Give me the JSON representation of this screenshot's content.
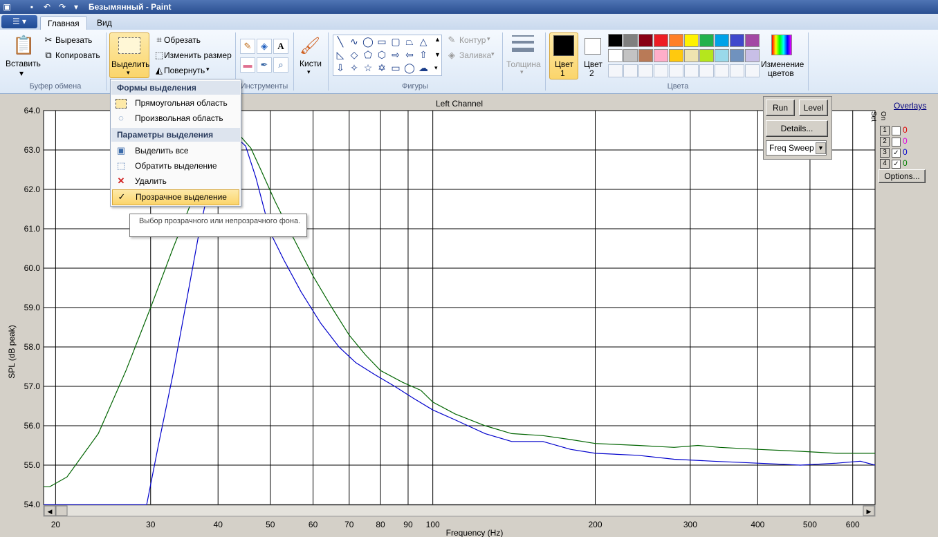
{
  "window": {
    "title": "Безымянный - Paint"
  },
  "tabs": [
    {
      "label": "Главная"
    },
    {
      "label": "Вид"
    }
  ],
  "ribbon": {
    "clipboard": {
      "paste": "Вставить",
      "cut": "Вырезать",
      "copy": "Копировать",
      "group": "Буфер обмена"
    },
    "image": {
      "select": "Выделить",
      "crop": "Обрезать",
      "resize": "Изменить размер",
      "rotate": "Повернуть"
    },
    "tools": {
      "group": "Инструменты"
    },
    "brushes": {
      "label": "Кисти"
    },
    "shapes": {
      "outline": "Контур",
      "fill": "Заливка",
      "group": "Фигуры"
    },
    "size": {
      "label": "Толщина"
    },
    "colors": {
      "color1": "Цвет",
      "color1_num": "1",
      "color2": "Цвет",
      "color2_num": "2",
      "edit": "Изменение",
      "edit2": "цветов",
      "group": "Цвета"
    },
    "palette": [
      "#000000",
      "#7f7f7f",
      "#880015",
      "#ed1c24",
      "#ff7f27",
      "#fff200",
      "#22b14c",
      "#00a2e8",
      "#3f48cc",
      "#a349a4",
      "#ffffff",
      "#c3c3c3",
      "#b97a57",
      "#ffaec9",
      "#ffc90e",
      "#efe4b0",
      "#b5e61d",
      "#99d9ea",
      "#7092be",
      "#c8bfe7"
    ]
  },
  "menu": {
    "head1": "Формы выделения",
    "rect": "Прямоугольная область",
    "free": "Произвольная область",
    "head2": "Параметры выделения",
    "all": "Выделить все",
    "invert": "Обратить выделение",
    "delete": "Удалить",
    "transparent": "Прозрачное выделение"
  },
  "tooltip": {
    "text": "Выбор прозрачного или непрозрачного фона."
  },
  "controls": {
    "run": "Run",
    "level": "Level",
    "details": "Details...",
    "sweep": "Freq Sweep",
    "overlays": "Overlays",
    "set": "Set",
    "on": "On",
    "options": "Options...",
    "sets": [
      {
        "num": "1",
        "checked": false,
        "value": "0",
        "color": "#e00000"
      },
      {
        "num": "2",
        "checked": false,
        "value": "0",
        "color": "#e000e0"
      },
      {
        "num": "3",
        "checked": true,
        "value": "0",
        "color": "#0000cc"
      },
      {
        "num": "4",
        "checked": true,
        "value": "0",
        "color": "#008000"
      }
    ]
  },
  "chart_data": {
    "type": "line",
    "title": "Left Channel",
    "xlabel": "Frequency (Hz)",
    "ylabel": "SPL (dB peak)",
    "xscale": "log",
    "xlim": [
      19,
      660
    ],
    "ylim": [
      54.0,
      64.0
    ],
    "yticks": [
      "64.0",
      "63.0",
      "62.0",
      "61.0",
      "60.0",
      "59.0",
      "58.0",
      "57.0",
      "56.0",
      "55.0",
      "54.0"
    ],
    "xticks": [
      20,
      30,
      40,
      50,
      60,
      70,
      80,
      90,
      100,
      200,
      300,
      400,
      500,
      600
    ],
    "grid": true,
    "series": [
      {
        "color": "#0000cc",
        "x": [
          19,
          20,
          25,
          29.5,
          31,
          33,
          35,
          37,
          39,
          41,
          43,
          45,
          47,
          50,
          53,
          57,
          62,
          67,
          72,
          78,
          85,
          92,
          100,
          110,
          125,
          140,
          160,
          180,
          200,
          240,
          280,
          330,
          400,
          480,
          560,
          620,
          660
        ],
        "y": [
          54.0,
          54.0,
          54.0,
          54.0,
          55.5,
          57.3,
          59.2,
          61.0,
          62.4,
          63.1,
          63.35,
          63.1,
          62.3,
          60.9,
          60.2,
          59.4,
          58.6,
          58.0,
          57.6,
          57.3,
          57.0,
          56.7,
          56.4,
          56.15,
          55.8,
          55.6,
          55.6,
          55.4,
          55.3,
          55.25,
          55.15,
          55.1,
          55.05,
          55.0,
          55.05,
          55.1,
          55.0
        ]
      },
      {
        "color": "#006400",
        "x": [
          19,
          19.5,
          21,
          24,
          27,
          30,
          33,
          36,
          39,
          42,
          44,
          46,
          48,
          51,
          55,
          60,
          65,
          70,
          75,
          80,
          88,
          95,
          100,
          110,
          125,
          140,
          160,
          180,
          200,
          240,
          280,
          310,
          340,
          400,
          480,
          560,
          620,
          660
        ],
        "y": [
          54.45,
          54.45,
          54.7,
          55.8,
          57.4,
          59.0,
          60.5,
          61.8,
          62.8,
          63.3,
          63.35,
          63.05,
          62.5,
          61.7,
          60.8,
          59.8,
          59.0,
          58.3,
          57.8,
          57.4,
          57.1,
          56.9,
          56.6,
          56.3,
          56.0,
          55.8,
          55.75,
          55.65,
          55.55,
          55.5,
          55.45,
          55.5,
          55.45,
          55.4,
          55.35,
          55.3,
          55.3,
          55.3
        ]
      }
    ]
  }
}
